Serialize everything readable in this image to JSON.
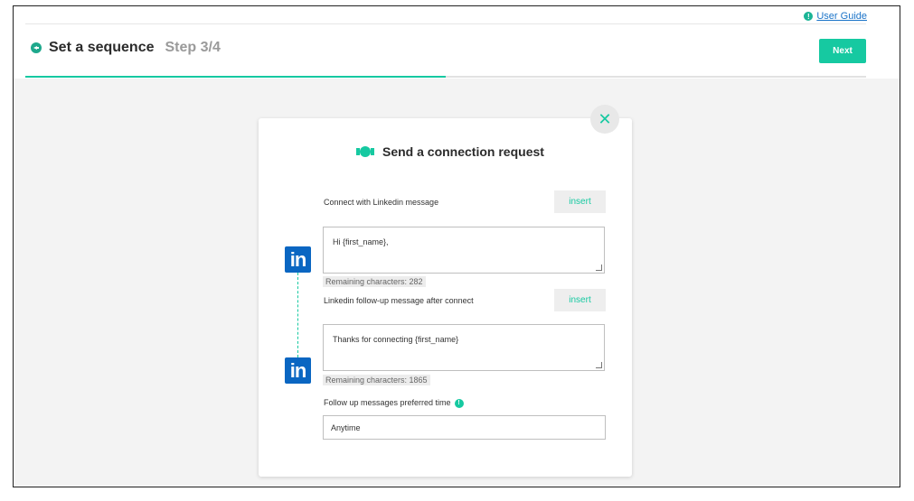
{
  "header": {
    "title": "Set a sequence",
    "step": "Step 3/4",
    "user_guide": "User Guide",
    "next_label": "Next"
  },
  "card": {
    "title": "Send a connection request",
    "connect_label": "Connect with Linkedin message",
    "insert_label": "insert",
    "connect_message": "Hi {first_name},",
    "connect_remaining": "Remaining characters: 282",
    "followup_label": "Linkedin follow-up message after connect",
    "followup_message": "Thanks for connecting {first_name}",
    "followup_remaining": "Remaining characters: 1865",
    "preferred_label": "Follow up messages preferred time",
    "preferred_value": "Anytime"
  },
  "progress": {
    "fraction": 0.5
  },
  "colors": {
    "accent": "#16c9a1",
    "linkedin": "#0a66c2"
  },
  "icons": [
    "back-arrow-icon",
    "info-icon",
    "close-icon",
    "handshake-icon",
    "linkedin-icon"
  ]
}
